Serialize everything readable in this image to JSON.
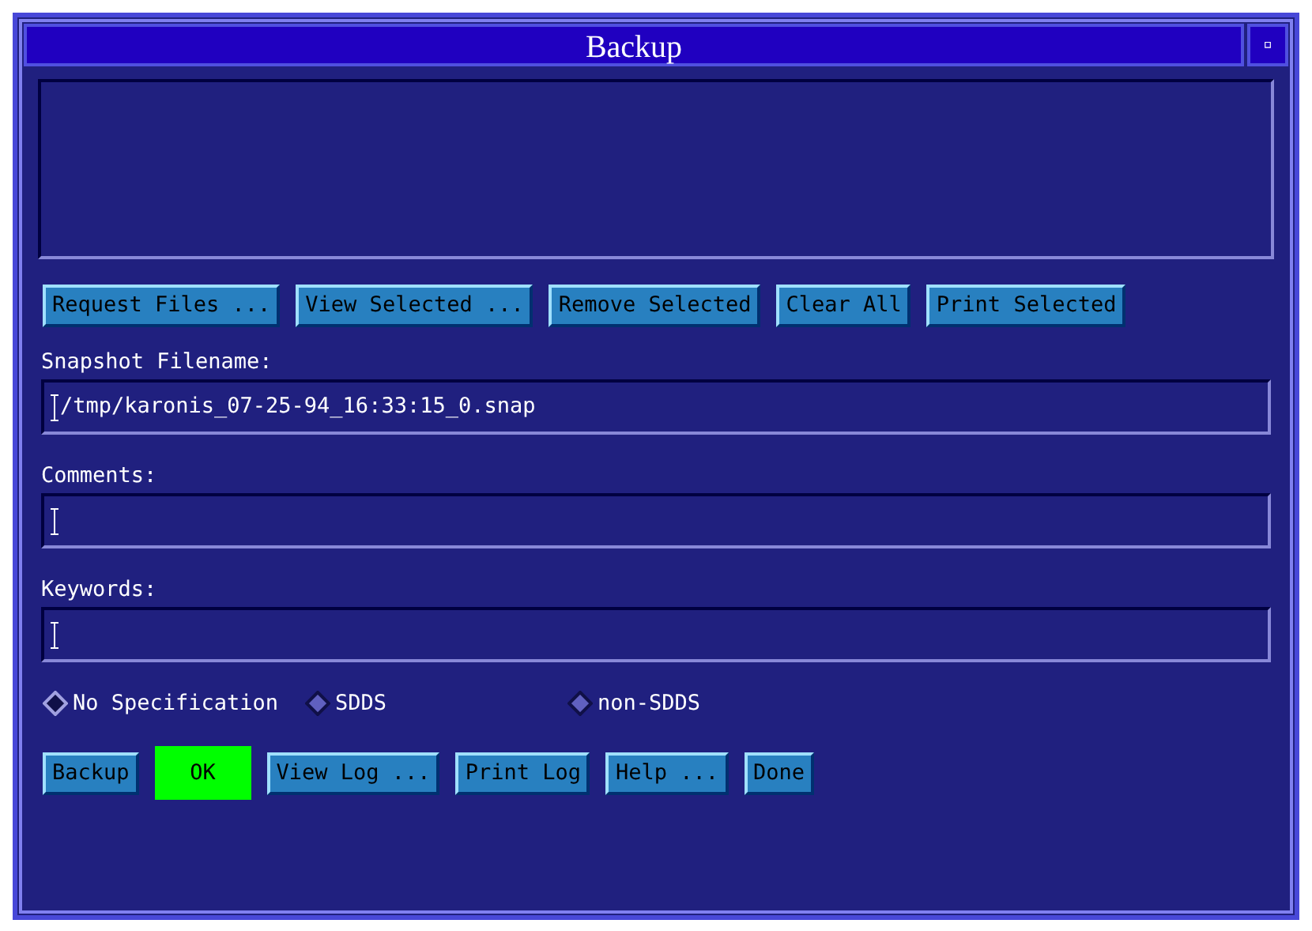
{
  "window": {
    "title": "Backup",
    "control": "▫"
  },
  "file_buttons": [
    "Request Files ...",
    "View Selected ...",
    "Remove Selected",
    "Clear All",
    "Print Selected"
  ],
  "fields": [
    {
      "label": "Snapshot Filename:",
      "value": "/tmp/karonis_07-25-94_16:33:15_0.snap"
    },
    {
      "label": "Comments:"
    },
    {
      "label": "Keywords:"
    }
  ],
  "radios": [
    {
      "label": "No Specification",
      "selected": true
    },
    {
      "label": "SDDS",
      "selected": false
    },
    {
      "label": "non-SDDS",
      "selected": false
    }
  ],
  "actions": [
    {
      "kind": "button",
      "label": "Backup"
    },
    {
      "kind": "indicator",
      "label": "OK",
      "color": "#00ff00"
    },
    {
      "kind": "button",
      "label": "View Log ..."
    },
    {
      "kind": "button",
      "label": "Print Log"
    },
    {
      "kind": "button",
      "label": "Help ..."
    },
    {
      "kind": "button",
      "label": "Done"
    }
  ]
}
